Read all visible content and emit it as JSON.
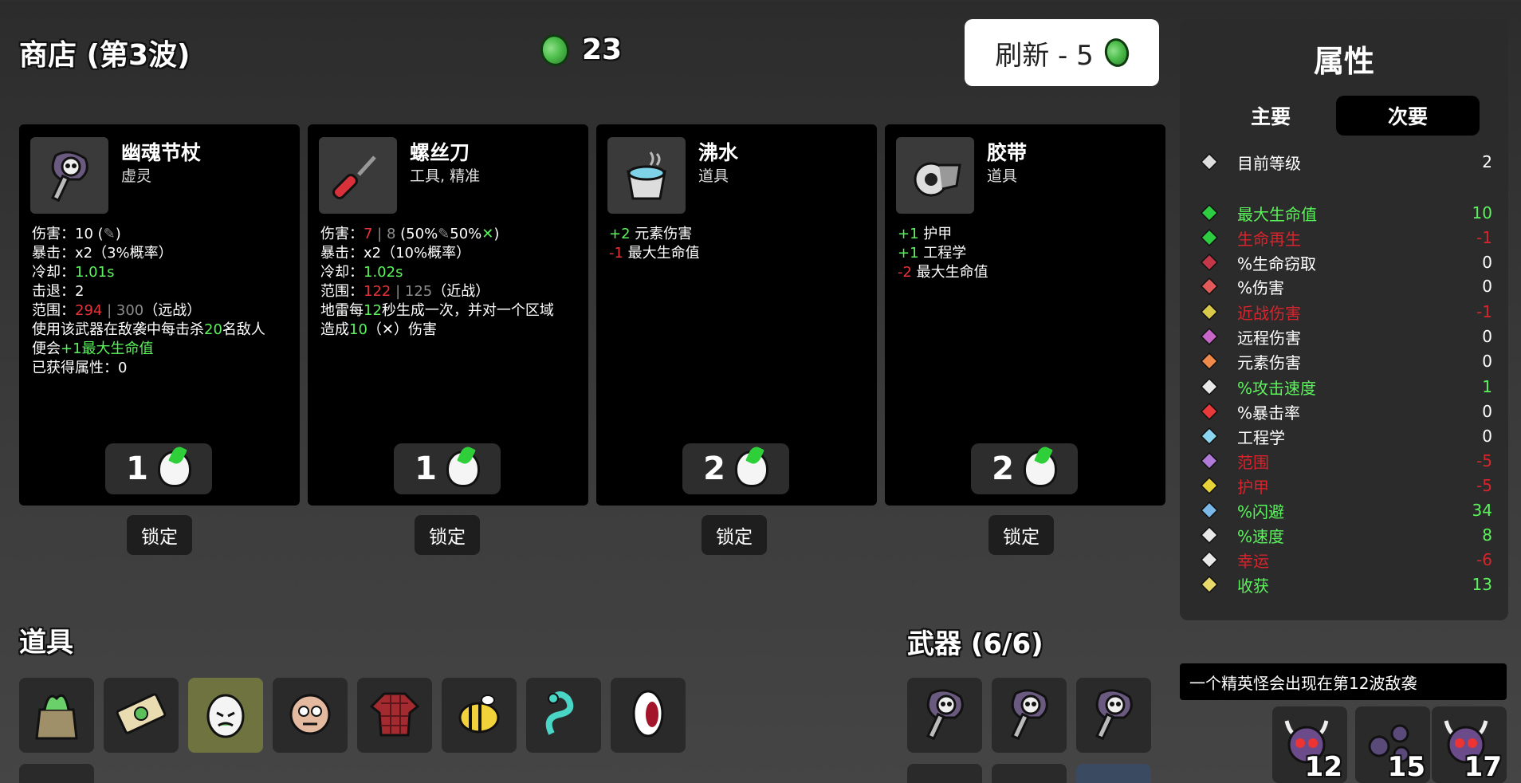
{
  "shop": {
    "title": "商店 (第3波)",
    "coins": "23"
  },
  "reroll": {
    "label": "刷新 - 5"
  },
  "cards": [
    {
      "name": "幽魂节杖",
      "type": "虚灵",
      "icon": "ghost-scepter-icon",
      "price": "1",
      "lock": "锁定",
      "lines": [
        [
          {
            "t": "伤害：10 ("
          },
          {
            "t": "✎",
            "c": "grey"
          },
          {
            "t": ")"
          }
        ],
        [
          {
            "t": "暴击：x2（3%概率）"
          }
        ],
        [
          {
            "t": "冷却："
          },
          {
            "t": "1.01s",
            "c": "green"
          }
        ],
        [
          {
            "t": "击退：2"
          }
        ],
        [
          {
            "t": "范围："
          },
          {
            "t": "294",
            "c": "red"
          },
          {
            "t": " | 300",
            "c": "grey"
          },
          {
            "t": "（远战）"
          }
        ],
        [
          {
            "t": "使用该武器在敌袭中每击杀"
          },
          {
            "t": "20",
            "c": "green"
          },
          {
            "t": "名敌人"
          }
        ],
        [
          {
            "t": "便会"
          },
          {
            "t": "+1最大生命值",
            "c": "green"
          }
        ],
        [
          {
            "t": "已获得属性：0"
          }
        ]
      ]
    },
    {
      "name": "螺丝刀",
      "type": "工具, 精准",
      "icon": "screwdriver-icon",
      "price": "1",
      "lock": "锁定",
      "lines": [
        [
          {
            "t": "伤害："
          },
          {
            "t": "7",
            "c": "red"
          },
          {
            "t": " | 8 ",
            "c": "grey"
          },
          {
            "t": "(50%"
          },
          {
            "t": "✎",
            "c": "grey"
          },
          {
            "t": "50%"
          },
          {
            "t": "✕",
            "c": "green"
          },
          {
            "t": ")"
          }
        ],
        [
          {
            "t": "暴击：x2（10%概率）"
          }
        ],
        [
          {
            "t": "冷却："
          },
          {
            "t": "1.02s",
            "c": "green"
          }
        ],
        [
          {
            "t": "范围："
          },
          {
            "t": "122",
            "c": "red"
          },
          {
            "t": " | 125",
            "c": "grey"
          },
          {
            "t": "（近战）"
          }
        ],
        [
          {
            "t": "地雷每"
          },
          {
            "t": "12",
            "c": "green"
          },
          {
            "t": "秒生成一次，并对一个区域"
          }
        ],
        [
          {
            "t": "造成"
          },
          {
            "t": "10",
            "c": "green"
          },
          {
            "t": "（✕）伤害"
          }
        ]
      ]
    },
    {
      "name": "沸水",
      "type": "道具",
      "icon": "boiling-water-icon",
      "price": "2",
      "lock": "锁定",
      "lines": [
        [
          {
            "t": "+2",
            "c": "green"
          },
          {
            "t": " 元素伤害"
          }
        ],
        [
          {
            "t": "-1",
            "c": "red"
          },
          {
            "t": " 最大生命值"
          }
        ]
      ]
    },
    {
      "name": "胶带",
      "type": "道具",
      "icon": "tape-icon",
      "price": "2",
      "lock": "锁定",
      "lines": [
        [
          {
            "t": "+1",
            "c": "green"
          },
          {
            "t": " 护甲"
          }
        ],
        [
          {
            "t": "+1",
            "c": "green"
          },
          {
            "t": " 工程学"
          }
        ],
        [
          {
            "t": "-2",
            "c": "red"
          },
          {
            "t": " 最大生命值"
          }
        ]
      ]
    }
  ],
  "items_section": {
    "title": "道具",
    "items": [
      "seed-bag-icon",
      "cash-icon",
      "egg-icon",
      "face-icon",
      "shirt-icon",
      "bee-icon",
      "alien-worm-icon",
      "mouth-icon"
    ]
  },
  "weapons_section": {
    "title": "武器 (6/6)",
    "weapons": [
      "ghost-scepter-icon",
      "ghost-scepter-icon",
      "ghost-scepter-icon"
    ]
  },
  "stats": {
    "title": "属性",
    "tab_primary": "主要",
    "tab_secondary": "次要",
    "rows": [
      {
        "label": "目前等级",
        "value": "2",
        "color": "#ffffff",
        "icon": "level-icon"
      },
      {
        "label": "最大生命值",
        "value": "10",
        "color": "#5bf35b",
        "icon": "heart-icon"
      },
      {
        "label": "生命再生",
        "value": "-1",
        "color": "#d8242c",
        "icon": "regen-icon"
      },
      {
        "label": "%生命窃取",
        "value": "0",
        "color": "#ffffff",
        "icon": "lifesteal-icon"
      },
      {
        "label": "%伤害",
        "value": "0",
        "color": "#ffffff",
        "icon": "damage-icon"
      },
      {
        "label": "近战伤害",
        "value": "-1",
        "color": "#d8242c",
        "icon": "melee-icon"
      },
      {
        "label": "远程伤害",
        "value": "0",
        "color": "#ffffff",
        "icon": "ranged-icon"
      },
      {
        "label": "元素伤害",
        "value": "0",
        "color": "#ffffff",
        "icon": "elemental-icon"
      },
      {
        "label": "%攻击速度",
        "value": "1",
        "color": "#5bf35b",
        "icon": "hourglass-icon"
      },
      {
        "label": "%暴击率",
        "value": "0",
        "color": "#ffffff",
        "icon": "crit-icon"
      },
      {
        "label": "工程学",
        "value": "0",
        "color": "#ffffff",
        "icon": "engineering-icon"
      },
      {
        "label": "范围",
        "value": "-5",
        "color": "#d8242c",
        "icon": "range-icon"
      },
      {
        "label": "护甲",
        "value": "-5",
        "color": "#d8242c",
        "icon": "armor-icon"
      },
      {
        "label": "%闪避",
        "value": "34",
        "color": "#5bf35b",
        "icon": "dodge-icon"
      },
      {
        "label": "%速度",
        "value": "8",
        "color": "#5bf35b",
        "icon": "speed-icon"
      },
      {
        "label": "幸运",
        "value": "-6",
        "color": "#d8242c",
        "icon": "luck-icon"
      },
      {
        "label": "收获",
        "value": "13",
        "color": "#5bf35b",
        "icon": "harvest-icon"
      }
    ]
  },
  "notice": "一个精英怪会出现在第12波敌袭",
  "enemies": [
    {
      "icon": "horned-skull-icon",
      "count": "12"
    },
    {
      "icon": "bugs-icon",
      "count": "15"
    },
    {
      "icon": "horned-skull-icon",
      "count": "17"
    }
  ]
}
